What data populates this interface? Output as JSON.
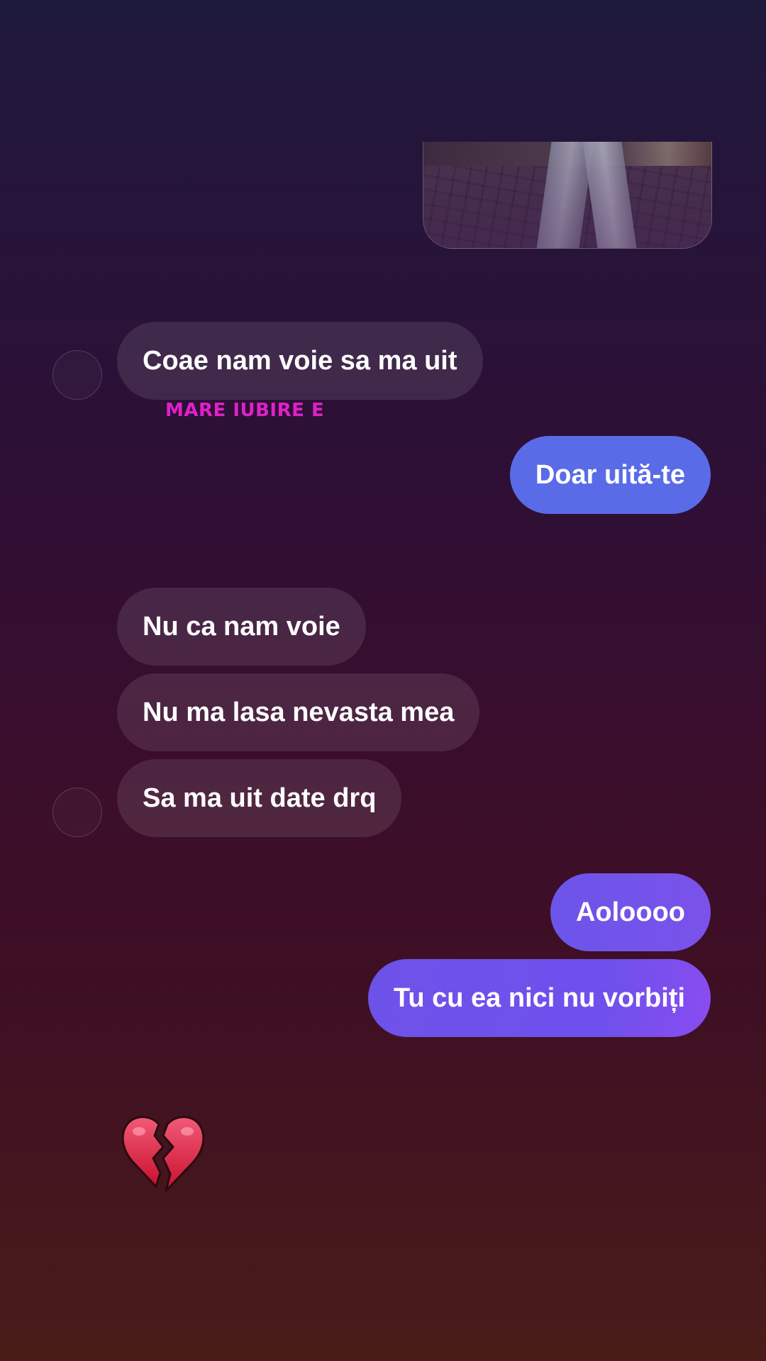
{
  "messages": {
    "m1": "Coae nam voie sa ma uit",
    "caption": "MARE IUBIRE E",
    "m2": "Doar uită-te",
    "m3": "Nu ca nam voie",
    "m4": "Nu ma lasa nevasta mea",
    "m5": "Sa ma uit date drq",
    "m6": "Aoloooo",
    "m7": "Tu cu ea nici nu vorbiți"
  },
  "colors": {
    "outgoing_blue": "#5a6be8",
    "outgoing_violet": "#6c55ea",
    "caption_magenta": "#e020c8",
    "incoming_bubble": "rgba(255,255,255,0.10)"
  },
  "icons": {
    "reaction": "broken-heart-icon"
  }
}
